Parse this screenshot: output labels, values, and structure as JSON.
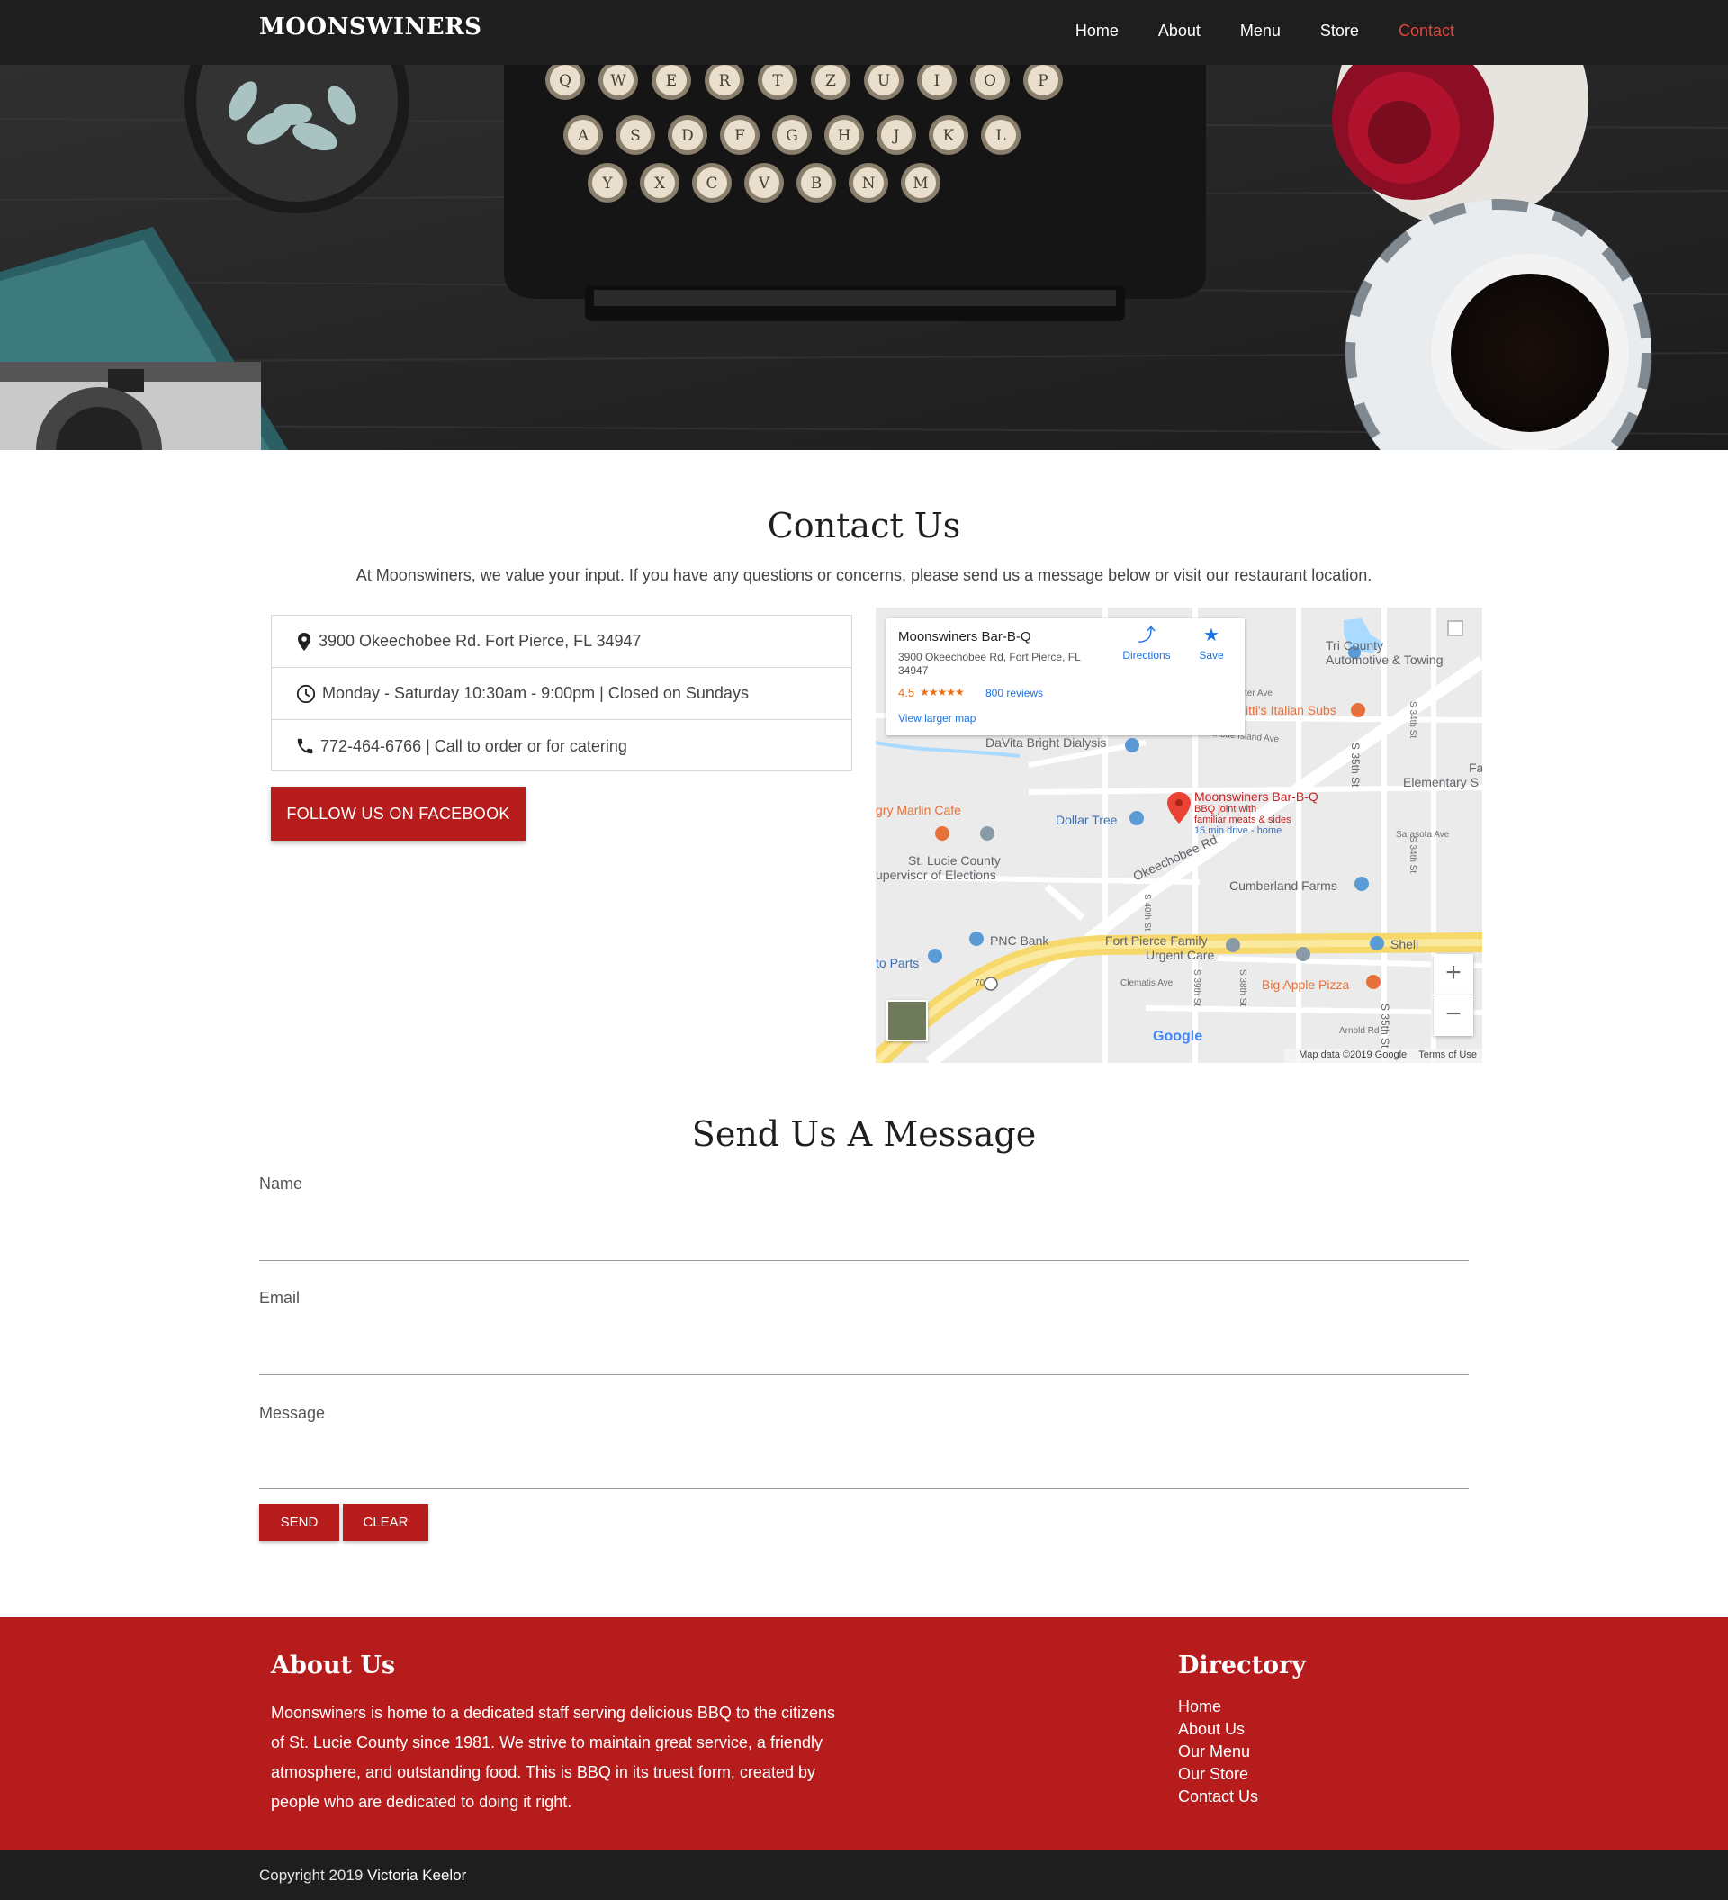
{
  "nav": {
    "brand": "MOONSWINERS",
    "links": [
      "Home",
      "About",
      "Menu",
      "Store",
      "Contact"
    ],
    "active": "Contact",
    "active_color": "#e0453a"
  },
  "hero": {
    "typewriter_keys_row1": [
      "Q",
      "W",
      "E",
      "R",
      "T",
      "Z",
      "U",
      "I",
      "O",
      "P"
    ],
    "typewriter_keys_row2": [
      "A",
      "S",
      "D",
      "F",
      "G",
      "H",
      "J",
      "K",
      "L"
    ],
    "typewriter_keys_row3": [
      "Y",
      "X",
      "C",
      "V",
      "B",
      "N",
      "M"
    ]
  },
  "contact": {
    "title": "Contact Us",
    "intro": "At Moonswiners, we value your input. If you have any questions or concerns, please send us a message below or visit our restaurant location.",
    "address": "3900 Okeechobee Rd. Fort Pierce, FL 34947",
    "hours": "Monday - Saturday 10:30am - 9:00pm | Closed on Sundays",
    "phone": "772-464-6766 | Call to order or for catering",
    "facebook_button": "FOLLOW US ON FACEBOOK"
  },
  "map": {
    "place_name": "Moonswiners Bar-B-Q",
    "place_address": "3900 Okeechobee Rd, Fort Pierce, FL 34947",
    "rating": "4.5",
    "stars": "★★★★★",
    "reviews": "800 reviews",
    "directions": "Directions",
    "save": "Save",
    "view_larger": "View larger map",
    "zoom_in": "+",
    "zoom_out": "−",
    "map_data": "Map data ©2019 Google",
    "terms": "Terms of Use",
    "google": "Google",
    "pin_title": "Moonswiners Bar-B-Q",
    "pin_sub1": "BBQ joint with",
    "pin_sub2": "familiar meats & sides",
    "pin_drive": "15 min drive - home",
    "labels": {
      "tri_county": "Tri County",
      "automotive": "Automotive & Towing",
      "ittis": "itti's Italian Subs",
      "davita": "DaVita Bright Dialysis",
      "rhode_island": "Rhode Island Ave",
      "marlin": "gry Marlin Cafe",
      "dollar_tree": "Dollar Tree",
      "st_lucie_1": "St. Lucie County",
      "st_lucie_2": "upervisor of Elections",
      "okeechobee": "Okeechobee Rd",
      "elementary": "Elementary S",
      "fa": "Fa",
      "sarasota": "Sarasota Ave",
      "cumberland": "Cumberland Farms",
      "pnc": "PNC Bank",
      "fp_family_1": "Fort Pierce Family",
      "fp_family_2": "Urgent Care",
      "shell": "Shell",
      "to_parts": "to Parts",
      "big_apple": "Big Apple Pizza",
      "clematis": "Clematis Ave",
      "arnold": "Arnold Rd",
      "s35_1": "S 35th St",
      "s35_2": "S 35th St",
      "s34_1": "S 34th St",
      "s34_2": "S 34th St",
      "s40": "S 40th St",
      "s39": "S 39th St",
      "s38": "S 38th St",
      "ter_ave": "ter Ave",
      "route70": "70"
    }
  },
  "message_form": {
    "title": "Send Us A Message",
    "name_label": "Name",
    "email_label": "Email",
    "message_label": "Message",
    "send": "SEND",
    "clear": "CLEAR"
  },
  "footer": {
    "about_title": "About Us",
    "about_text": "Moonswiners is home to a dedicated staff serving delicious BBQ to the citizens of St. Lucie County since 1981. We strive to maintain great service, a friendly atmosphere, and outstanding food. This is BBQ in its truest form, created by people who are dedicated to doing it right.",
    "directory_title": "Directory",
    "directory_links": [
      "Home",
      "About Us",
      "Our Menu",
      "Our Store",
      "Contact Us"
    ],
    "copyright_prefix": "Copyright 2019",
    "copyright_name": "Victoria Keelor",
    "background_color": "#b71c1c"
  }
}
